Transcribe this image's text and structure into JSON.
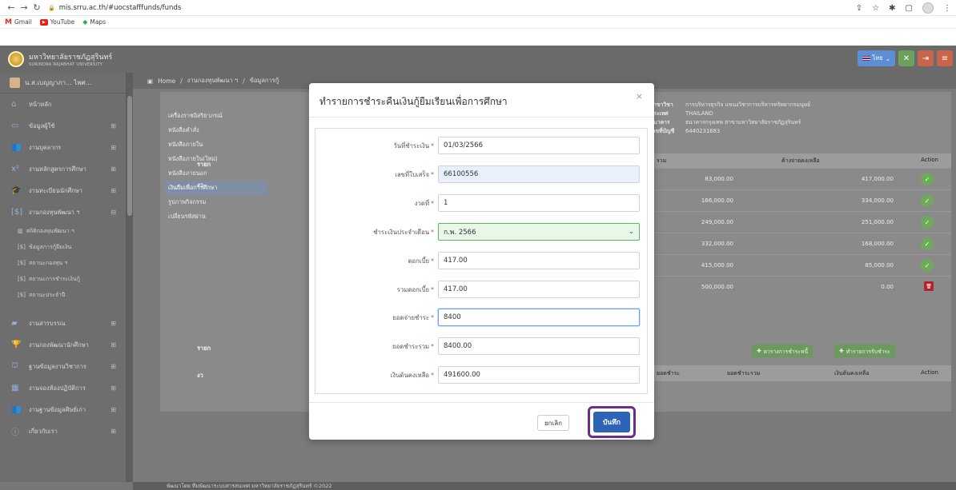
{
  "browser": {
    "url": "mis.srru.ac.th/#uocstafffunds/funds",
    "bookmarks": [
      {
        "label": "Gmail"
      },
      {
        "label": "YouTube"
      },
      {
        "label": "Maps"
      }
    ]
  },
  "header": {
    "uni_name_th": "มหาวิทยาลัยราชภัฏสุรินทร์",
    "uni_name_en": "SURINDRA RAJABHAT UNIVERSITY",
    "lang_label": "ไทย"
  },
  "sidebar": {
    "user_name": "น.ส.เบญญาภา... ไพศ...",
    "items": [
      {
        "label": "หน้าหลัก"
      },
      {
        "label": "ข้อมูลผู้ใช้"
      },
      {
        "label": "งานบุคลากร"
      },
      {
        "label": "งานหลักสูตรการศึกษา"
      },
      {
        "label": "งานทะเบียนนักศึกษา"
      },
      {
        "label": "งานกองทุนพัฒนา ฯ"
      }
    ],
    "subitems": [
      {
        "label": "สถิติกองทุนพัฒนา ฯ"
      },
      {
        "label": "ข้อมูลการกู้ยืมเงิน"
      },
      {
        "label": "สถานะกองทุน ฯ"
      },
      {
        "label": "สถานะการชำระเงินกู้"
      },
      {
        "label": "สถานะประจำปี"
      }
    ],
    "items2": [
      {
        "label": "งานสารบรรณ"
      },
      {
        "label": "งานกองพัฒนานักศึกษา"
      },
      {
        "label": "ฐานข้อมูลงานวิชาการ"
      },
      {
        "label": "งานจองห้องปฏิบัติการ"
      },
      {
        "label": "งานฐานข้อมูลศิษย์เก่า"
      },
      {
        "label": "เกี่ยวกับเรา"
      }
    ]
  },
  "breadcrumb": {
    "home": "Home",
    "level1": "งานกองทุนพัฒนา ฯ",
    "level2": "ข้อมูลการกู้"
  },
  "submenu": [
    {
      "label": "เครื่องราชอิสริยาภรณ์"
    },
    {
      "label": "หนังสือคำสั่ง"
    },
    {
      "label": "หนังสือภายใน"
    },
    {
      "label": "หนังสือภายใน(ใหม่)"
    },
    {
      "label": "หนังสือภายนอก"
    },
    {
      "label": "เงินยืมเพื่อการศึกษา"
    },
    {
      "label": "รูปภาพกิจกรรม"
    },
    {
      "label": "เปลี่ยนรหัสผ่าน"
    }
  ],
  "section_labels": {
    "list1": "รายก",
    "list2": "รายก",
    "col_ngan": "งว",
    "col_ngan2": "งว"
  },
  "info": {
    "rows": [
      {
        "label": "สาขาวิชา",
        "value": "การบริหารธุรกิจ แขนงวิชาการบริหารทรัพยากรมนุษย์"
      },
      {
        "label": "ประเทศ",
        "value": "THAILAND"
      },
      {
        "label": "ธนาคาร",
        "value": "ธนาคารกรุงเทพ สาขามหาวิทยาลัยราชภัฏสุรินทร์"
      },
      {
        "label": "เลขที่บัญชี",
        "value": "6440231683"
      }
    ]
  },
  "loan_table": {
    "headers": {
      "total": "รวม",
      "remaining": "ค้างจ่ายคงเหลือ",
      "action": "Action"
    },
    "rows": [
      {
        "no": "1",
        "total": "83,000.00",
        "remaining": "417,000.00",
        "status": "check"
      },
      {
        "no": "2",
        "total": "166,000.00",
        "remaining": "334,000.00",
        "status": "check"
      },
      {
        "no": "3",
        "total": "249,000.00",
        "remaining": "251,000.00",
        "status": "check"
      },
      {
        "no": "4",
        "total": "332,000.00",
        "remaining": "168,000.00",
        "status": "check"
      },
      {
        "no": "5",
        "total": "415,000.00",
        "remaining": "85,000.00",
        "status": "check"
      },
      {
        "no": "6",
        "total": "500,000.00",
        "remaining": "0.00",
        "status": "delete"
      }
    ]
  },
  "repay_buttons": {
    "schedule": "ตารางการชำระหนี้",
    "add": "ทำรายการรับชำระ"
  },
  "repay_table": {
    "headers": {
      "paid": "ยอดชำระ",
      "paid_total": "ยอดชำระรวม",
      "balance": "เงินต้นคงเหลือ",
      "action": "Action"
    }
  },
  "footer": "พัฒนาโดย ทีมพัฒนาระบบสารสนเทศ มหาวิทยาลัยราชภัฏสุรินทร์ ©2022",
  "modal": {
    "title": "ทำรายการชำระคืนเงินกู้ยืมเรียนเพื่อการศึกษา",
    "fields": {
      "pay_date": {
        "label": "วันที่ชำระเงิน",
        "value": "01/03/2566"
      },
      "receipt_no": {
        "label": "เลขที่ใบเสร็จ",
        "value": "66100556"
      },
      "installment": {
        "label": "งวดที่",
        "value": "1"
      },
      "pay_month": {
        "label": "ชำระเงินประจำเดือน",
        "value": "ก.พ. 2566"
      },
      "interest": {
        "label": "ดอกเบี้ย",
        "value": "417.00"
      },
      "interest_total": {
        "label": "รวมดอกเบี้ย",
        "value": "417.00"
      },
      "pay_amount": {
        "label": "ยอดจ่ายชำระ",
        "value": "8400"
      },
      "pay_total": {
        "label": "ยอดชำระรวม",
        "value": "8400.00"
      },
      "principal_left": {
        "label": "เงินต้นคงเหลือ",
        "value": "491600.00"
      }
    },
    "cancel_label": "ยกเลิก",
    "save_label": "บันทึก"
  },
  "colors": {
    "primary": "#2f63b8",
    "highlight_frame": "#6d2b8c",
    "success": "#6fa95a",
    "danger": "#b2242d"
  }
}
